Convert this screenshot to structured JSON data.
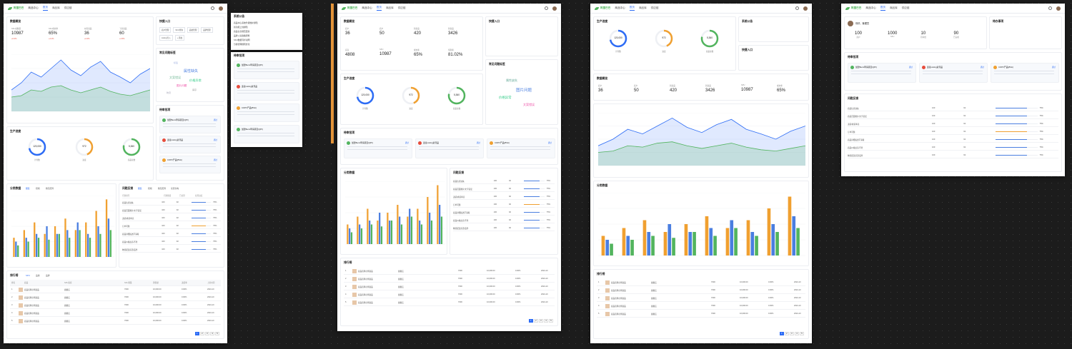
{
  "app": {
    "logo_text": "阿里巴巴",
    "center": "商品中心"
  },
  "nav_tabs": [
    "首页",
    "商品库",
    "供应链"
  ],
  "colors": {
    "accent": "#2d6cf5",
    "green": "#52b45e",
    "orange": "#f0a030",
    "red": "#e74c3c"
  },
  "board1": {
    "title_overview": "数据概览",
    "kpi": [
      {
        "label": "SKU总数量",
        "value": "10987",
        "change": "+0.2%"
      },
      {
        "label": "SKU成交率",
        "value": "65%",
        "change": "+4.1%"
      },
      {
        "label": "在售商品",
        "value": "36",
        "change": "+2.2%"
      },
      {
        "label": "下架商品",
        "value": "60",
        "change": "+1.5%"
      }
    ],
    "shortcuts_title": "快捷入口",
    "shortcuts": [
      "商户管理",
      "SKU查询",
      "品类管理",
      "品牌管理",
      "Listing导入",
      "+ 添加"
    ],
    "wordcloud_title": "常见问题标签",
    "production_title": "生产进度",
    "gauges": [
      {
        "label": "计划数",
        "value": "120,000",
        "pct": 0.72,
        "color": "#2d6cf5"
      },
      {
        "label": "进度",
        "value": "972",
        "pct": 0.44,
        "color": "#f0a030"
      },
      {
        "label": "商品总数",
        "value": "5,360",
        "pct": 0.78,
        "color": "#52b45e"
      }
    ],
    "approval_title": "待审批项",
    "approvals": [
      {
        "title": "加盟Bemi申请项目(QPI)",
        "color": "#52b45e",
        "action": "通过"
      },
      {
        "title": "连接Listing资讯品",
        "color": "#e74c3c",
        "action": "通过"
      },
      {
        "title": "COPV产品(BVA)",
        "color": "#f0a030",
        "action": "通过"
      }
    ],
    "sales_title": "分类数据",
    "sales_tabs": [
      "服装",
      "鞋帽",
      "箱包配饰"
    ],
    "ranking_title": "问题反馈",
    "ranking_tabs": [
      "服装",
      "鞋帽",
      "箱包配饰",
      "家居家电"
    ],
    "ranking_head": [
      "问题类型",
      "问题数量",
      "已处理",
      "处理进度"
    ],
    "rank_rows": [
      {
        "name": "商品信息缺失",
        "count": "100",
        "done": "92",
        "pct": "75%"
      },
      {
        "name": "商品页面图片/文字错误",
        "count": "100",
        "done": "92",
        "pct": "75%"
      },
      {
        "name": "退货/换货率高",
        "count": "100",
        "done": "92",
        "pct": "75%"
      },
      {
        "name": "订单问题",
        "count": "100",
        "done": "92",
        "pct": "75%"
      },
      {
        "name": "商品详细描述不清晰",
        "count": "100",
        "done": "92",
        "pct": "75%"
      },
      {
        "name": "商品价格虚高/不准",
        "count": "100",
        "done": "92",
        "pct": "75%"
      },
      {
        "name": "物流配送延迟/丢件",
        "count": "100",
        "done": "92",
        "pct": "75%"
      }
    ],
    "table_title": "排行榜",
    "table_tabs": [
      "SPU",
      "品类",
      "品牌"
    ],
    "table_head": [
      "排名",
      "商品",
      "SPU商家",
      "SKU销量",
      "销售额",
      "退货率",
      "上架时间"
    ],
    "table_rows": [
      {
        "rank": "1",
        "name": "商品名称示例商品",
        "shop": "旗舰店",
        "sales": "7000",
        "amount": "10,000.00",
        "ret": "0.00%",
        "date": "2024-10"
      },
      {
        "rank": "2",
        "name": "商品名称示例商品",
        "shop": "旗舰店",
        "sales": "7000",
        "amount": "10,000.00",
        "ret": "0.00%",
        "date": "2024-10"
      },
      {
        "rank": "3",
        "name": "商品名称示例商品",
        "shop": "旗舰店",
        "sales": "7000",
        "amount": "10,000.00",
        "ret": "0.00%",
        "date": "2024-10"
      },
      {
        "rank": "4",
        "name": "商品名称示例商品",
        "shop": "旗舰店",
        "sales": "7000",
        "amount": "10,000.00",
        "ret": "0.00%",
        "date": "2024-10"
      },
      {
        "rank": "5",
        "name": "商品名称示例商品",
        "shop": "旗舰店",
        "sales": "7000",
        "amount": "10,000.00",
        "ret": "0.00%",
        "date": "2024-10"
      }
    ],
    "pages": [
      "1",
      "2",
      "3",
      "4",
      "5"
    ]
  },
  "board2": {
    "title": "系统公告",
    "items": [
      "商品中心系统升级维护通知",
      "新功能上线通知",
      "商品信息规范更新",
      "品牌入驻政策调整",
      "SKU数据同步说明",
      "分类管理规则优化"
    ],
    "approvals": [
      "加盟Bemi申请项目(QPI)",
      "连接Listing资讯品",
      "COPV产品(BVA)",
      "加盟Bemi申请项目(QPI)"
    ]
  },
  "board3": {
    "kpi": [
      {
        "label": "商户",
        "value": "36"
      },
      {
        "label": "商户",
        "value": "50"
      },
      {
        "label": "新商品",
        "value": "420"
      },
      {
        "label": "新商品",
        "value": "3426"
      },
      {
        "label": "库存",
        "value": "4808"
      },
      {
        "label": "SPU",
        "value": "10987"
      },
      {
        "label": "成交率",
        "value": "65%"
      },
      {
        "label": "毛利率",
        "value": "81.02%"
      }
    ]
  },
  "board4": {
    "kpi": [
      {
        "label": "商户",
        "value": "36"
      },
      {
        "label": "商户",
        "value": "50"
      },
      {
        "label": "新商品",
        "value": "420"
      },
      {
        "label": "新商品",
        "value": "3426"
      },
      {
        "label": "SPU",
        "value": "10987"
      },
      {
        "label": "成交率",
        "value": "65%"
      }
    ]
  },
  "board5": {
    "user_greeting": "你好，管理员",
    "stats": [
      {
        "value": "100",
        "label": "商户"
      },
      {
        "value": "1000",
        "label": "SKU"
      },
      {
        "value": "10",
        "label": "待审批"
      },
      {
        "value": "90",
        "label": "已完成"
      }
    ],
    "todo_title": "待办事项"
  },
  "chart_data": [
    {
      "type": "area",
      "series": [
        {
          "values": [
            30,
            40,
            55,
            48,
            60,
            72,
            58,
            50,
            62,
            70,
            55,
            48,
            40,
            52,
            60
          ]
        },
        {
          "values": [
            20,
            22,
            30,
            28,
            34,
            36,
            30,
            26,
            30,
            34,
            28,
            24,
            22,
            26,
            30
          ]
        }
      ]
    },
    {
      "type": "bar",
      "categories": [
        "1",
        "2",
        "3",
        "4",
        "5",
        "6",
        "7",
        "8",
        "9",
        "10"
      ],
      "series": [
        {
          "values": [
            10,
            14,
            18,
            12,
            16,
            20,
            14,
            18,
            24,
            30
          ]
        },
        {
          "values": [
            8,
            10,
            12,
            16,
            12,
            14,
            18,
            12,
            16,
            20
          ]
        },
        {
          "values": [
            6,
            8,
            10,
            9,
            12,
            10,
            14,
            10,
            12,
            14
          ]
        }
      ]
    }
  ]
}
